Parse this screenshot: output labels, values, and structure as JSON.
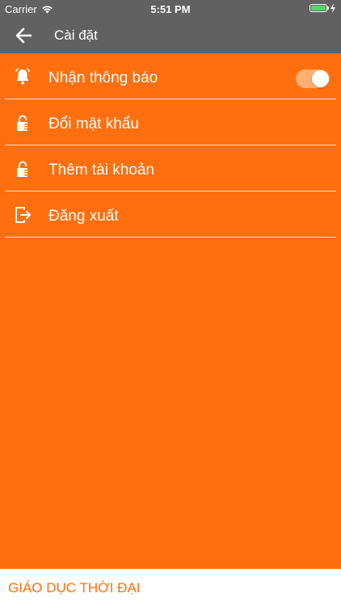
{
  "status_bar": {
    "carrier": "Carrier",
    "time": "5:51 PM",
    "wifi_icon": "wifi-icon",
    "battery_icon": "battery-icon",
    "charging_icon": "charging-icon"
  },
  "nav": {
    "title": "Cài đặt",
    "back_icon": "back-arrow-icon"
  },
  "menu": {
    "items": [
      {
        "label": "Nhận thông báo",
        "icon": "bell-alarm-icon",
        "toggle": true
      },
      {
        "label": "Đổi mật khẩu",
        "icon": "lock-icon"
      },
      {
        "label": "Thêm tài khoản",
        "icon": "lock-icon"
      },
      {
        "label": "Đăng xuất",
        "icon": "logout-icon"
      }
    ]
  },
  "footer": {
    "brand": "GIÁO DỤC THỜI ĐẠI"
  },
  "colors": {
    "accent": "#ff6f0f",
    "header": "#616161",
    "toggle_track": "#ffb072",
    "footer_bg": "#ffffff"
  }
}
